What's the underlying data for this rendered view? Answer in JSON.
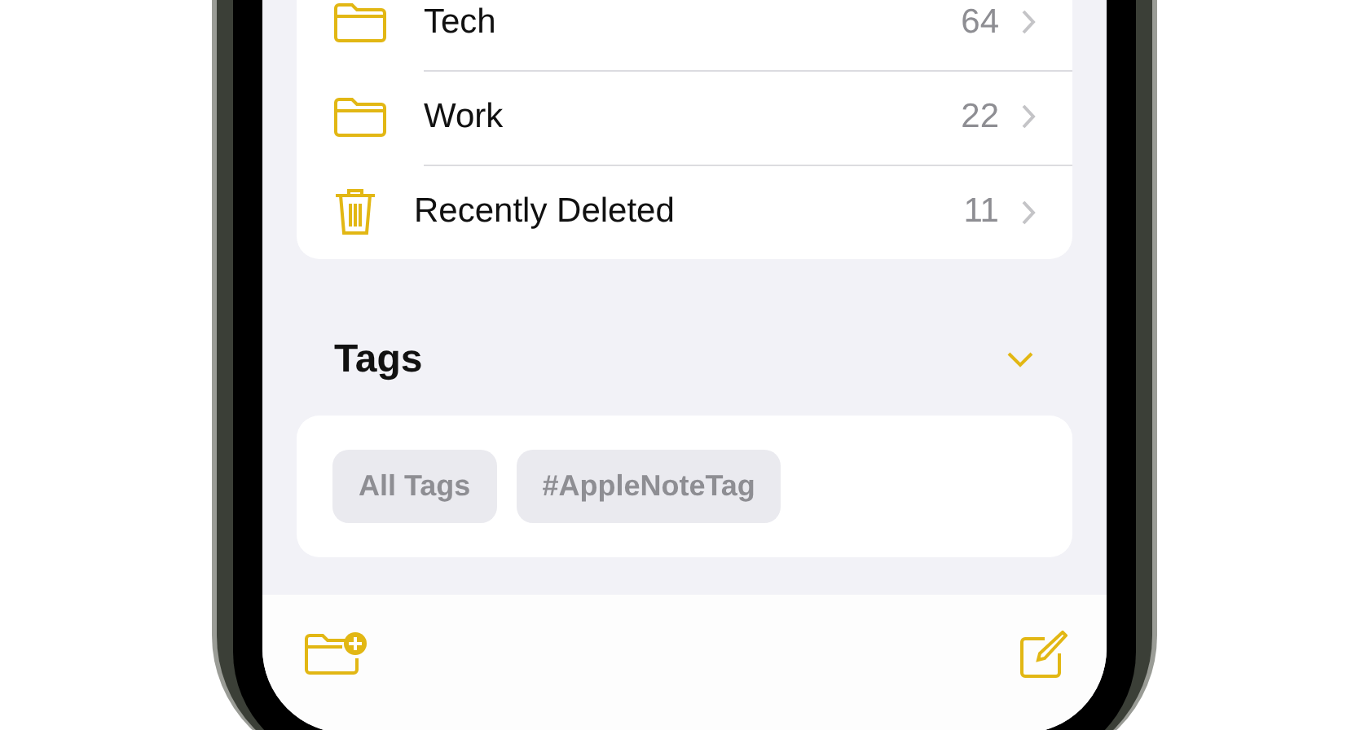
{
  "folders": [
    {
      "kind": "folder",
      "name": "Tech",
      "count": "64"
    },
    {
      "kind": "folder",
      "name": "Work",
      "count": "22"
    },
    {
      "kind": "trash",
      "name": "Recently Deleted",
      "count": "11"
    }
  ],
  "tags_section": {
    "title": "Tags",
    "expanded": true
  },
  "tags": [
    "All Tags",
    "#AppleNoteTag"
  ]
}
